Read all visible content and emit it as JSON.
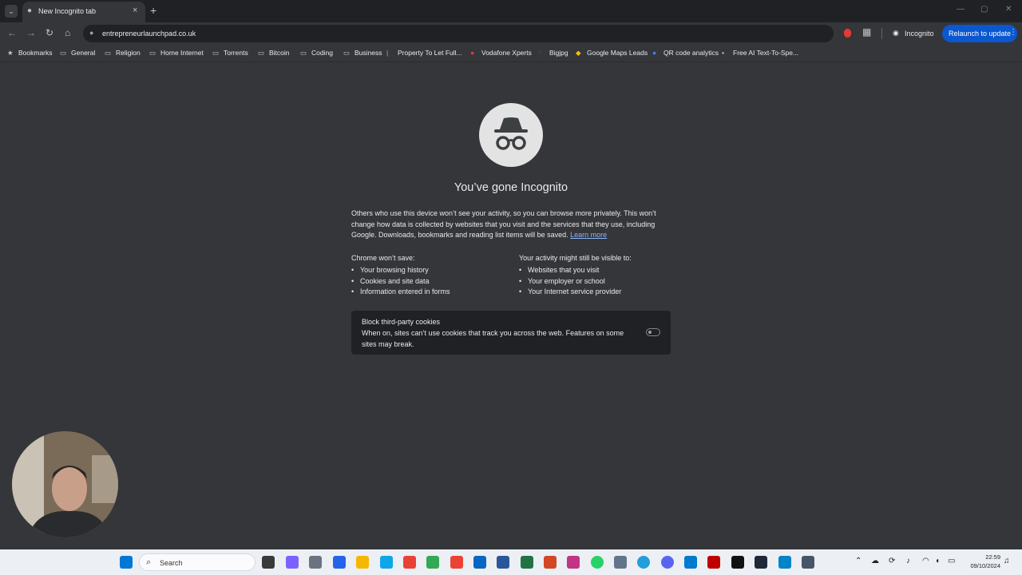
{
  "browser": {
    "tab": {
      "title": "New Incognito tab",
      "icon": "incognito-icon",
      "close": "×"
    },
    "new_tab": "+",
    "tab_menu": "⌄",
    "window_controls": {
      "minimize": "—",
      "maximize": "▢",
      "close": "✕"
    },
    "toolbar": {
      "back": "←",
      "forward": "→",
      "reload": "↻",
      "home": "⌂",
      "url": "entrepreneurlaunchpad.co.uk",
      "incognito_label": "Incognito",
      "relaunch_label": "Relaunch to update",
      "menu": "⋮"
    },
    "bookmarks": [
      {
        "label": "Bookmarks",
        "icon": "star-icon"
      },
      {
        "label": "General",
        "icon": "folder-icon"
      },
      {
        "label": "Religion",
        "icon": "folder-icon"
      },
      {
        "label": "Home Internet",
        "icon": "folder-icon"
      },
      {
        "label": "Torrents",
        "icon": "folder-icon"
      },
      {
        "label": "Bitcoin",
        "icon": "folder-icon"
      },
      {
        "label": "Coding",
        "icon": "folder-icon"
      },
      {
        "label": "Business",
        "icon": "folder-icon"
      },
      {
        "label": "Property To Let Full...",
        "icon": "page-icon"
      },
      {
        "label": "Vodafone Xperts",
        "icon": "vodafone-icon"
      },
      {
        "label": "Bigjpg",
        "icon": "bigjpg-icon"
      },
      {
        "label": "Google Maps Leads",
        "icon": "maps-icon"
      },
      {
        "label": "QR code analytics",
        "icon": "qr-icon"
      },
      {
        "label": "Free AI Text-To-Spe...",
        "icon": "tts-icon"
      }
    ]
  },
  "ntp": {
    "headline": "You’ve gone Incognito",
    "description": "Others who use this device won’t see your activity, so you can browse more privately. This won’t change how data is collected by websites that you visit and the services that they use, including Google. Downloads, bookmarks and reading list items will be saved.",
    "learn_more": "Learn more",
    "wont_save": {
      "title": "Chrome won’t save:",
      "items": [
        "Your browsing history",
        "Cookies and site data",
        "Information entered in forms"
      ]
    },
    "might_be_visible": {
      "title": "Your activity might still be visible to:",
      "items": [
        "Websites that you visit",
        "Your employer or school",
        "Your Internet service provider"
      ]
    },
    "cookies": {
      "title": "Block third-party cookies",
      "description": "When on, sites can’t use cookies that track you across the web. Features on some sites may break.",
      "enabled": false
    }
  },
  "taskbar": {
    "search_label": "Search",
    "time": "22:59",
    "date": "09/10/2024",
    "accent": "#0b57d0"
  }
}
